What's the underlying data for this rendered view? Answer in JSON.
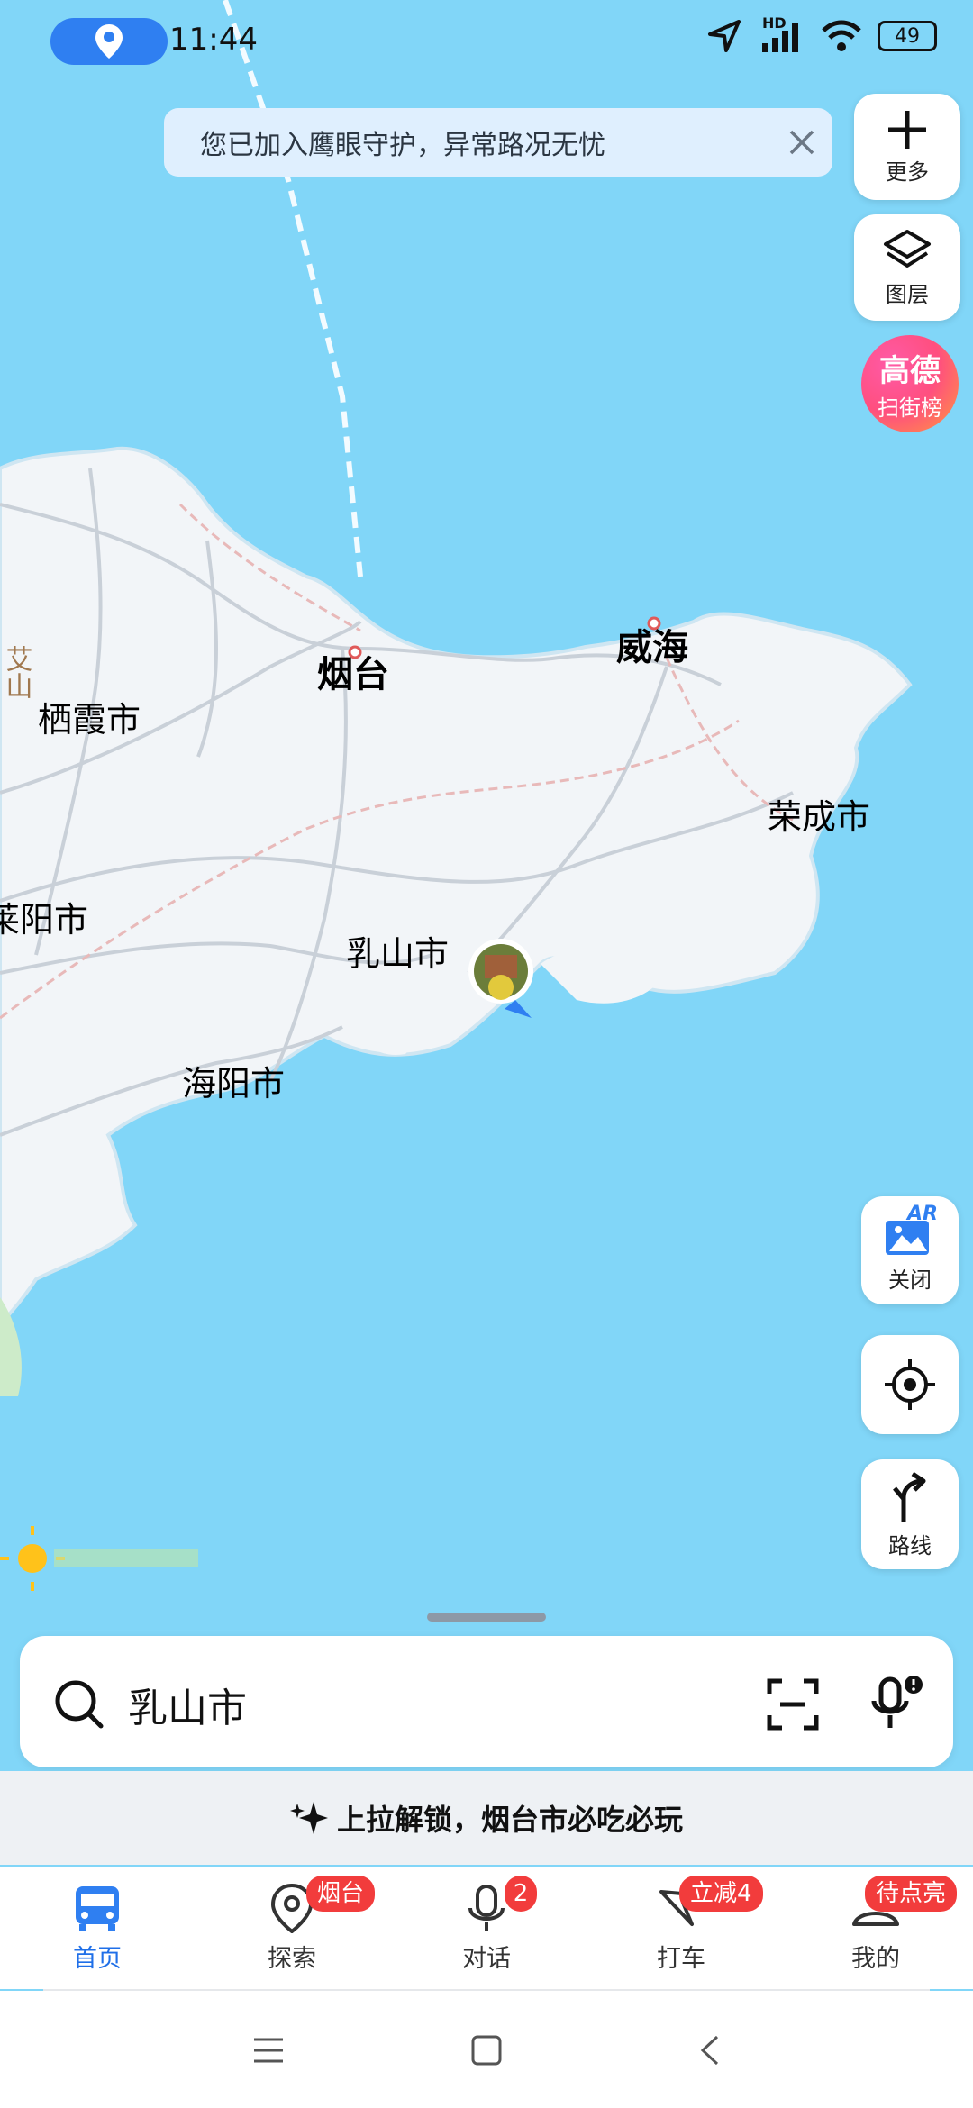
{
  "status_bar": {
    "time": "11:44",
    "network_label": "HD",
    "battery": "49",
    "icons": [
      "location-pin-icon",
      "navigation-arrow-icon",
      "signal-icon",
      "wifi-icon",
      "battery-icon"
    ]
  },
  "notice": {
    "text": "您已加入鹰眼守护，异常路况无忧"
  },
  "map": {
    "labels": {
      "yantai": "烟台",
      "weihai": "威海",
      "qixia": "栖霞市",
      "rongcheng": "荣成市",
      "laiyang": "莱阳市",
      "rushan": "乳山市",
      "haiyang": "海阳市",
      "aishan": "艾山"
    },
    "colors": {
      "sea": "#81d6f8",
      "land": "#f2f5f8",
      "road": "#c9d0d8"
    }
  },
  "right_buttons": {
    "more": "更多",
    "layers": "图层",
    "gaode_top": "高德",
    "gaode_bottom": "扫街榜",
    "ar_badge": "AR",
    "ar": "关闭",
    "route": "路线"
  },
  "search": {
    "value": "乳山市"
  },
  "promo": {
    "text": "上拉解锁，烟台市必吃必玩"
  },
  "tabs": [
    {
      "label": "首页",
      "badge": ""
    },
    {
      "label": "探索",
      "badge": "烟台"
    },
    {
      "label": "对话",
      "badge": "2"
    },
    {
      "label": "打车",
      "badge": "立减4"
    },
    {
      "label": "我的",
      "badge": "待点亮"
    }
  ],
  "accent": "#2f7ff1"
}
